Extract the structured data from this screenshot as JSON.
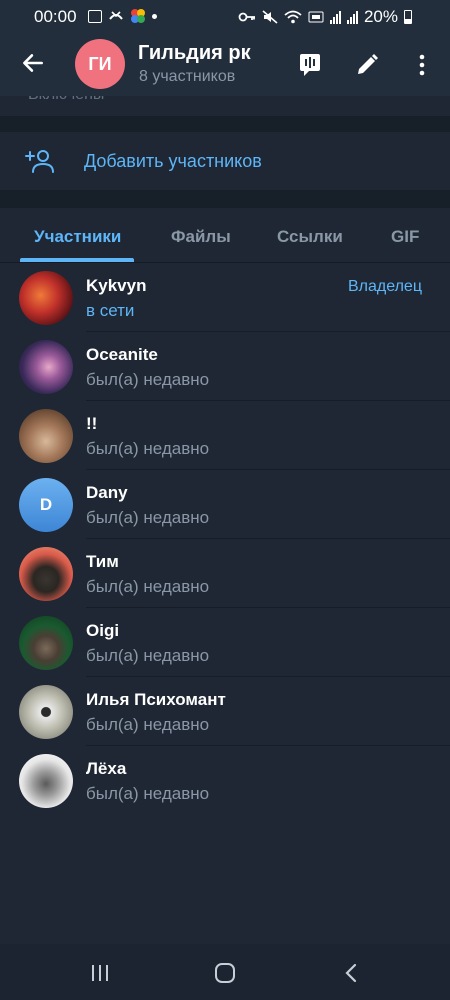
{
  "status_bar": {
    "time": "00:00",
    "battery": "20%",
    "left_icons": [
      "gallery-icon",
      "missed-call-icon",
      "photos-icon",
      "dot-icon"
    ],
    "right_icons": [
      "vpn-key-icon",
      "mute-icon",
      "wifi-icon",
      "volte-icon",
      "signal-icon",
      "signal-icon",
      "battery-icon"
    ]
  },
  "header": {
    "avatar_initials": "ГИ",
    "avatar_color": "#f0727f",
    "title": "Гильдия рк",
    "subtitle": "8 участников"
  },
  "partial_text": "Включены",
  "add_members": {
    "label": "Добавить участников"
  },
  "tabs": [
    {
      "label": "Участники",
      "active": true
    },
    {
      "label": "Файлы",
      "active": false
    },
    {
      "label": "Ссылки",
      "active": false
    },
    {
      "label": "GIF",
      "active": false
    }
  ],
  "members": [
    {
      "name": "Kykvyn",
      "status": "в сети",
      "role": "Владелец",
      "online": true
    },
    {
      "name": "Oceanite",
      "status": "был(а) недавно"
    },
    {
      "name": "!!",
      "status": "был(а) недавно"
    },
    {
      "name": "Dany",
      "status": "был(а) недавно",
      "initial": "D"
    },
    {
      "name": "Тим",
      "status": "был(а) недавно"
    },
    {
      "name": "Oigi",
      "status": "был(а) недавно"
    },
    {
      "name": "Илья Психомант",
      "status": "был(а) недавно"
    },
    {
      "name": "Лёха",
      "status": "был(а) недавно"
    }
  ],
  "colors": {
    "accent": "#5eb5f7",
    "background": "#1e2733",
    "header": "#232e3c",
    "secondary_text": "#8a97a6"
  }
}
